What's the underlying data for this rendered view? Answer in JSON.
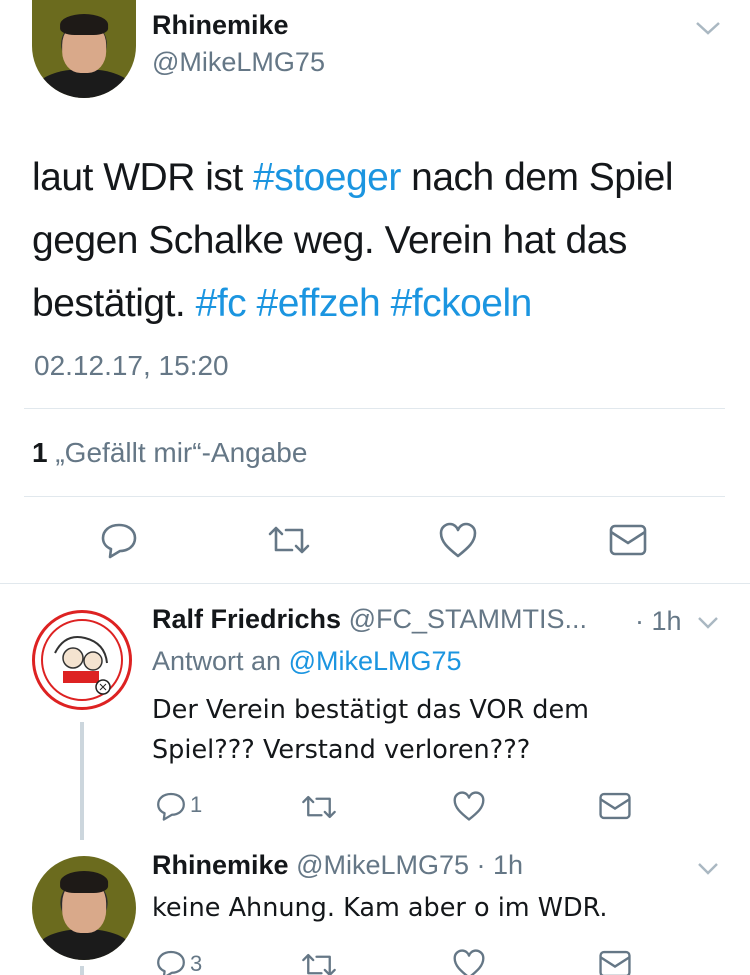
{
  "main_tweet": {
    "author_name": "Rhinemike",
    "author_handle": "@MikeLMG75",
    "text_1": "laut WDR ist",
    "hashtag_stoeger": "#stoeger",
    "text_2": "nach dem Spiel",
    "text_3": "gegen Schalke weg. Verein hat das",
    "text_4": "bestätigt.",
    "hashtag_fc": "#fc",
    "hashtag_effzeh": "#effzeh",
    "hashtag_fckoeln": "#fckoeln",
    "timestamp": "02.12.17, 15:20",
    "likes_count": "1",
    "likes_label": "„Gefällt mir“-Angabe"
  },
  "replies": [
    {
      "author_name": "Ralf Friedrichs",
      "author_handle": "@FC_STAMMTIS...",
      "time": "· 1h",
      "reply_to_label": "Antwort an",
      "reply_to_handle": "@MikeLMG75",
      "text_line_1": "Der Verein bestätigt das VOR dem",
      "text_line_2": "Spiel??? Verstand verloren???",
      "reply_count": "1"
    },
    {
      "author_name": "Rhinemike",
      "author_handle": "@MikeLMG75",
      "time": "· 1h",
      "text_line_1": "keine Ahnung. Kam aber o im WDR.",
      "reply_count": "3"
    }
  ],
  "icons": {
    "reply": "reply-icon",
    "retweet": "retweet-icon",
    "like": "heart-icon",
    "message": "envelope-icon",
    "menu": "chevron-down-icon"
  },
  "colors": {
    "link": "#1b95e0",
    "secondary": "#657786",
    "divider": "#e1e8ed"
  }
}
